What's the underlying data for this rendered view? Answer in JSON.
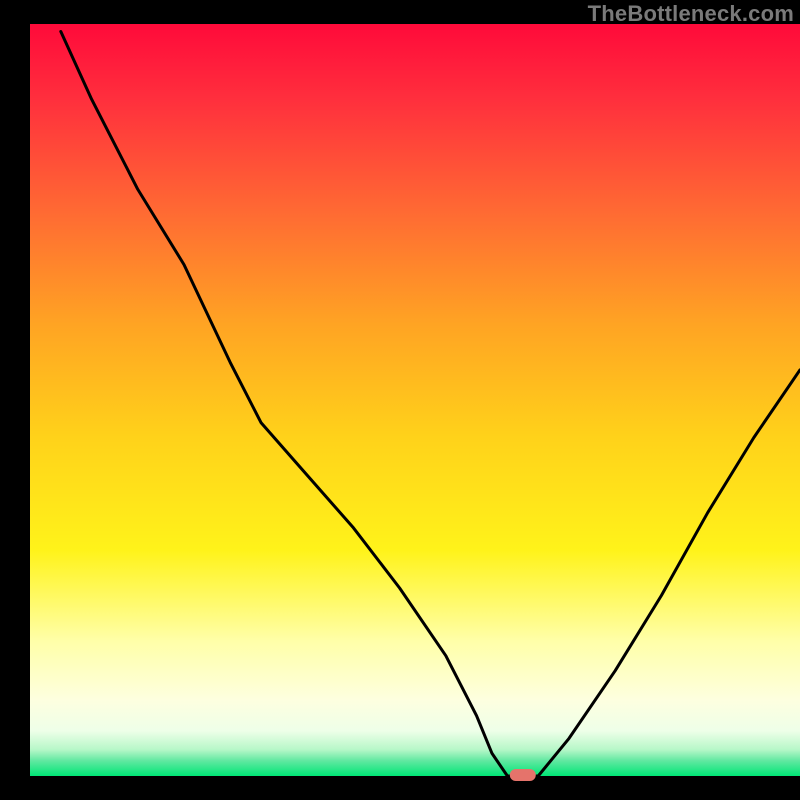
{
  "watermark": "TheBottleneck.com",
  "chart_data": {
    "type": "line",
    "title": "",
    "xlabel": "",
    "ylabel": "",
    "xlim": [
      0,
      100
    ],
    "ylim": [
      0,
      100
    ],
    "grid": false,
    "legend": false,
    "background": {
      "type": "vertical-gradient",
      "band_bottom": "#00e676",
      "desc": "red at top → orange → yellow → pale yellow → thin green band at bottom"
    },
    "note": "Curve values estimated from pixel positions; y is approximate bottleneck % (0 at bottom, 100 at top).",
    "series": [
      {
        "name": "bottleneck-curve",
        "x": [
          4,
          8,
          14,
          20,
          26,
          30,
          36,
          42,
          48,
          54,
          58,
          60,
          62,
          64,
          66,
          70,
          76,
          82,
          88,
          94,
          100
        ],
        "y": [
          99,
          90,
          78,
          68,
          55,
          47,
          40,
          33,
          25,
          16,
          8,
          3,
          0,
          0,
          0,
          5,
          14,
          24,
          35,
          45,
          54
        ]
      }
    ],
    "marker": {
      "x": 64,
      "y": 0,
      "color": "#e5736b",
      "shape": "rounded-rect"
    },
    "colors": {
      "curve": "#000000",
      "frame": "#000000",
      "marker": "#e5736b",
      "watermark": "#7a7a7a"
    }
  }
}
